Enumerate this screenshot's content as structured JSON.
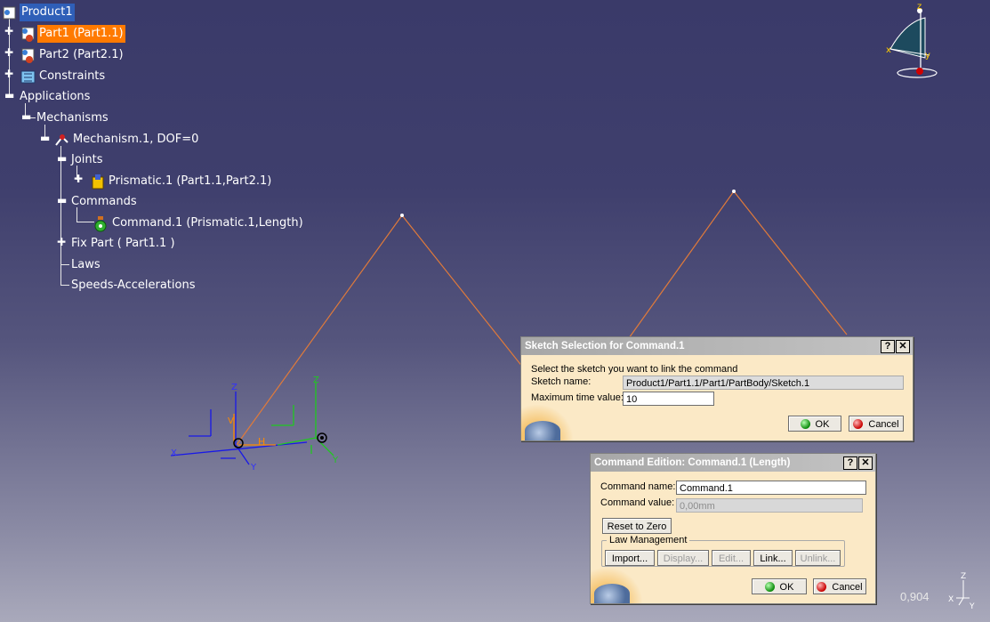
{
  "tree": {
    "root": "Product1",
    "part1": "Part1 (Part1.1)",
    "part2": "Part2 (Part2.1)",
    "constraints": "Constraints",
    "applications": "Applications",
    "mechanisms": "Mechanisms",
    "mechanism": "Mechanism.1, DOF=0",
    "joints": "Joints",
    "prismatic": "Prismatic.1 (Part1.1,Part2.1)",
    "commands": "Commands",
    "command": "Command.1 (Prismatic.1,Length)",
    "fixpart": "Fix Part ( Part1.1 )",
    "laws": "Laws",
    "speeds": "Speeds-Accelerations"
  },
  "sketch_dialog": {
    "title": "Sketch Selection for Command.1",
    "help": "?",
    "close": "✕",
    "instruction": "Select the sketch you want to link the command",
    "sketch_label": "Sketch name:",
    "sketch_value": "Product1/Part1.1/Part1/PartBody/Sketch.1",
    "max_time_label": "Maximum time value:",
    "max_time_value": "10",
    "ok": "OK",
    "cancel": "Cancel"
  },
  "command_dialog": {
    "title": "Command Edition: Command.1 (Length)",
    "help": "?",
    "close": "✕",
    "name_label": "Command name:",
    "name_value": "Command.1",
    "value_label": "Command value:",
    "value_value": "0,00mm",
    "reset": "Reset to Zero",
    "law_group": "Law Management",
    "import": "Import...",
    "display": "Display...",
    "edit": "Edit...",
    "link": "Link...",
    "unlink": "Unlink...",
    "ok": "OK",
    "cancel": "Cancel"
  },
  "viewport": {
    "zoom": "0,904",
    "axis_labels": {
      "z": "Z",
      "x": "X",
      "y": "Y",
      "h": "H",
      "v": "V"
    },
    "compass_labels": {
      "x": "x",
      "y": "y",
      "z": "z"
    }
  },
  "colors": {
    "selection": "#2f5fb8",
    "highlight": "#ff7a00",
    "sketch_line": "#e07a3a",
    "dialog_bg": "#fbe9c6"
  },
  "icons": {
    "product": "product-icon",
    "part": "part-icon",
    "constraints": "constraints-icon",
    "mechanism": "mechanism-icon",
    "prismatic": "prismatic-joint-icon",
    "command": "command-icon",
    "compass": "compass-icon",
    "ok": "ok-icon",
    "cancel": "cancel-icon"
  }
}
